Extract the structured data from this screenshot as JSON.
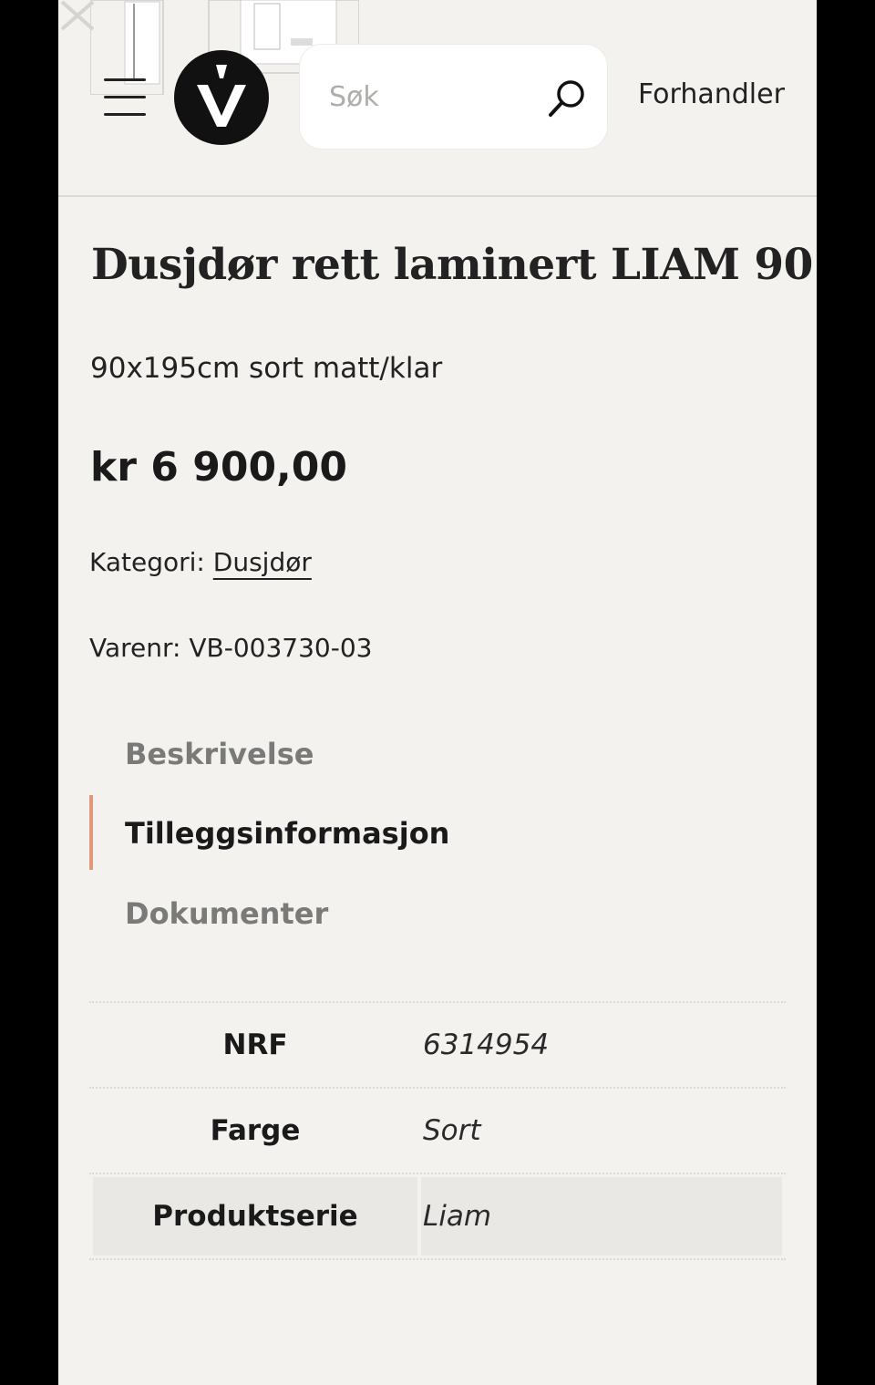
{
  "header": {
    "search_placeholder": "Søk",
    "dealer_link": "Forhandler"
  },
  "product": {
    "title": "Dusjdør rett laminert LIAM 90",
    "subtitle": "90x195cm sort matt/klar",
    "price": "kr 6 900,00",
    "category_label": "Kategori:",
    "category_value": "Dusjdør",
    "sku": "Varenr: VB-003730-03"
  },
  "tabs": [
    {
      "label": "Beskrivelse",
      "active": false
    },
    {
      "label": "Tilleggsinformasjon",
      "active": true
    },
    {
      "label": "Dokumenter",
      "active": false
    }
  ],
  "specs": [
    {
      "key": "NRF",
      "value": "6314954"
    },
    {
      "key": "Farge",
      "value": "Sort"
    },
    {
      "key": "Produktserie",
      "value": "Liam"
    }
  ],
  "colors": {
    "accent": "#e0977c",
    "background": "#f3f2ef",
    "logo": "#111111"
  }
}
